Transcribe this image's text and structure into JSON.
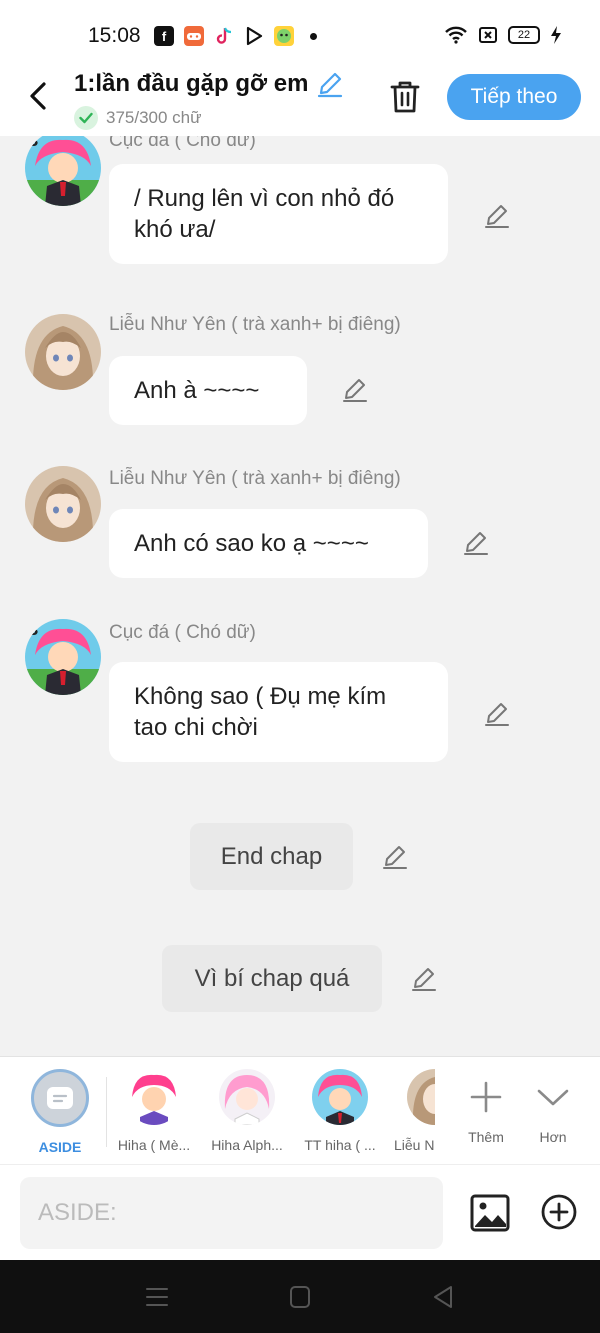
{
  "status_bar": {
    "time": "15:08",
    "battery": "22"
  },
  "header": {
    "title": "1:lần đầu gặp gỡ em",
    "word_count": "375/300 chữ",
    "next_label": "Tiếp theo"
  },
  "messages": [
    {
      "sender": "Cục đá ( Chó dữ)",
      "text": "/ Rung lên vì con nhỏ đó khó ưa/"
    },
    {
      "sender": "Liễu Như Yên ( trà xanh+ bị điêng)",
      "text": "Anh à ~~~~"
    },
    {
      "sender": "Liễu Như Yên ( trà xanh+ bị điêng)",
      "text": "Anh có sao ko ạ ~~~~"
    },
    {
      "sender": "Cục đá ( Chó dữ)",
      "text": "Không sao ( Đụ mẹ kím tao chi chời"
    }
  ],
  "asides": [
    {
      "text": "End chap"
    },
    {
      "text": "Vì bí chap quá"
    }
  ],
  "characters": {
    "aside_label": "ASIDE",
    "items": [
      "Hiha ( Mè...",
      "Hiha Alph...",
      "TT hiha ( ...",
      "Liễu N"
    ],
    "more_label": "Thêm",
    "collapse_label": "Hơn"
  },
  "composer": {
    "placeholder": "ASIDE:"
  },
  "colors": {
    "accent": "#4aa3f0",
    "aside_label": "#3d8ee0",
    "background": "#f2f2f2"
  },
  "icons": [
    "back-arrow-icon",
    "pencil-icon",
    "check-icon",
    "trash-icon",
    "image-icon",
    "plus-circle-icon",
    "plus-icon",
    "chevron-down-icon"
  ]
}
